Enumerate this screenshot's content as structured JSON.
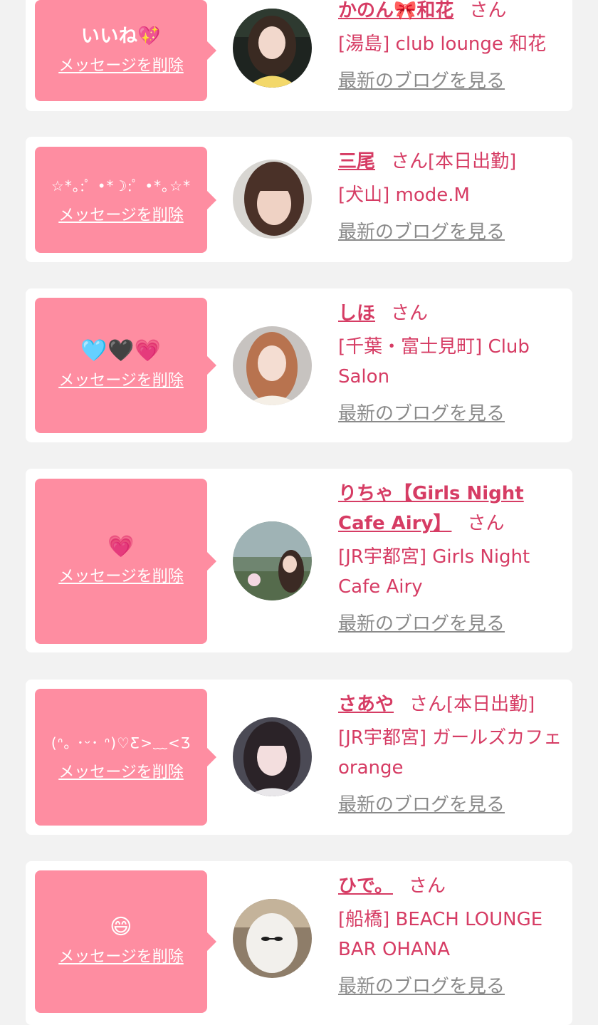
{
  "colors": {
    "page_bg": "#f2f2f2",
    "card_bg": "#ffffff",
    "bubble_bg": "#fe8da1",
    "accent_pink": "#d63c64",
    "link_gray": "#8a8a8a"
  },
  "delete_label": "メッセージを削除",
  "blog_label": "最新のブログを見る",
  "honorific": "さん",
  "items": [
    {
      "message": "いいね💖",
      "name": "かのん🎀和花",
      "status": "",
      "shop": "[湯島] club lounge 和花"
    },
    {
      "message": "☆*｡:ﾟ •*☽:ﾟ •*｡☆*",
      "name": "三尾",
      "status": "[本日出勤]",
      "shop": "[犬山] mode.M"
    },
    {
      "message": "🩵🖤💗",
      "name": "しほ",
      "status": "",
      "shop": "[千葉・富士見町] Club Salon"
    },
    {
      "message": "💗",
      "name": "りちゃ【Girls Night Cafe Airy】",
      "status": "",
      "shop": "[JR宇都宮] Girls Night Cafe Airy"
    },
    {
      "message": "(ᐢ｡ ･ᵕ･ ᐢ)♡Ƹ>﹏<Ʒ",
      "name": "さあや",
      "status": "[本日出勤]",
      "shop": "[JR宇都宮] ガールズカフェ orange"
    },
    {
      "message": "😄",
      "name": "ひで。",
      "status": "",
      "shop": "[船橋] BEACH LOUNGE BAR OHANA"
    }
  ]
}
